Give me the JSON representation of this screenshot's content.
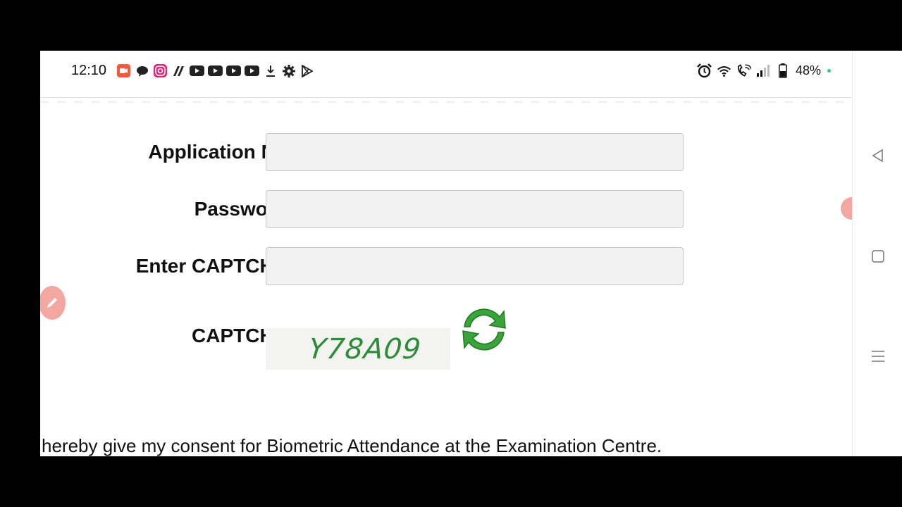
{
  "status_bar": {
    "time": "12:10",
    "battery": "48%",
    "notification_icons": [
      "screen-recorder-icon",
      "chat-icon",
      "instagram-icon",
      "app-icon",
      "youtube-icon",
      "youtube-icon",
      "youtube-icon",
      "youtube-icon",
      "download-icon",
      "gear-icon",
      "play-store-icon"
    ],
    "right_icons": [
      "alarm-icon",
      "wifi-icon",
      "wifi-call-icon",
      "signal-icon",
      "battery-icon"
    ]
  },
  "form": {
    "application_no_label": "Application No :",
    "application_no_value": "",
    "password_label": "Password :",
    "password_value": "",
    "captcha_input_label": "Enter CAPTCHA :",
    "captcha_input_value": "",
    "captcha_label": "CAPTCHA :",
    "captcha_text": "Y78A09"
  },
  "consent_text": "hereby give my consent for Biometric Attendance at the Examination Centre.",
  "colors": {
    "captcha": "#2e8b3a",
    "refresh": "#3aa43a",
    "bubble": "#f3a7a0"
  }
}
